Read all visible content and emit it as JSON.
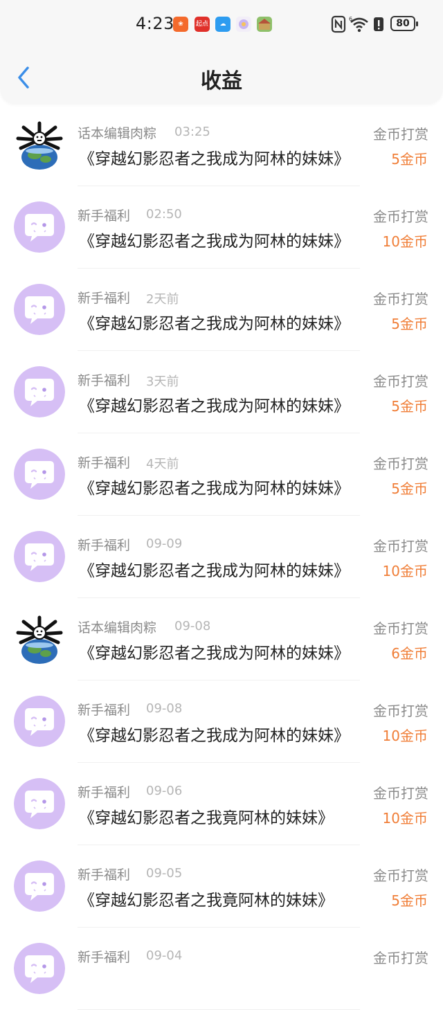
{
  "status_bar": {
    "time": "4:23",
    "battery": "80",
    "apps": [
      "kuaishou-icon",
      "qidian-icon",
      "cloud-icon",
      "chat-icon",
      "game-icon"
    ],
    "qidian_label": "起点",
    "signal_label": "6"
  },
  "header": {
    "title": "收益",
    "back_icon": "chevron-left-icon",
    "accent": "#3b8ee8"
  },
  "colors": {
    "amount": "#f07d36",
    "sender": "#8a8a8a",
    "time": "#b5b5b5",
    "avatar_purple": "#d6bff5"
  },
  "items": [
    {
      "sender": "话本编辑肉粽",
      "time": "03:25",
      "book": "《穿越幻影忍者之我成为阿林的妹妹》",
      "type": "金币打赏",
      "amount": "5金币",
      "avatar": "editor-avatar"
    },
    {
      "sender": "新手福利",
      "time": "02:50",
      "book": "《穿越幻影忍者之我成为阿林的妹妹》",
      "type": "金币打赏",
      "amount": "10金币",
      "avatar": "welfare-avatar"
    },
    {
      "sender": "新手福利",
      "time": "2天前",
      "book": "《穿越幻影忍者之我成为阿林的妹妹》",
      "type": "金币打赏",
      "amount": "5金币",
      "avatar": "welfare-avatar"
    },
    {
      "sender": "新手福利",
      "time": "3天前",
      "book": "《穿越幻影忍者之我成为阿林的妹妹》",
      "type": "金币打赏",
      "amount": "5金币",
      "avatar": "welfare-avatar"
    },
    {
      "sender": "新手福利",
      "time": "4天前",
      "book": "《穿越幻影忍者之我成为阿林的妹妹》",
      "type": "金币打赏",
      "amount": "5金币",
      "avatar": "welfare-avatar"
    },
    {
      "sender": "新手福利",
      "time": "09-09",
      "book": "《穿越幻影忍者之我成为阿林的妹妹》",
      "type": "金币打赏",
      "amount": "10金币",
      "avatar": "welfare-avatar"
    },
    {
      "sender": "话本编辑肉粽",
      "time": "09-08",
      "book": "《穿越幻影忍者之我成为阿林的妹妹》",
      "type": "金币打赏",
      "amount": "6金币",
      "avatar": "editor-avatar"
    },
    {
      "sender": "新手福利",
      "time": "09-08",
      "book": "《穿越幻影忍者之我成为阿林的妹妹》",
      "type": "金币打赏",
      "amount": "10金币",
      "avatar": "welfare-avatar"
    },
    {
      "sender": "新手福利",
      "time": "09-06",
      "book": "《穿越幻影忍者之我竟阿林的妹妹》",
      "type": "金币打赏",
      "amount": "10金币",
      "avatar": "welfare-avatar"
    },
    {
      "sender": "新手福利",
      "time": "09-05",
      "book": "《穿越幻影忍者之我竟阿林的妹妹》",
      "type": "金币打赏",
      "amount": "5金币",
      "avatar": "welfare-avatar"
    },
    {
      "sender": "新手福利",
      "time": "09-04",
      "book": "",
      "type": "金币打赏",
      "amount": "",
      "avatar": "welfare-avatar"
    }
  ]
}
